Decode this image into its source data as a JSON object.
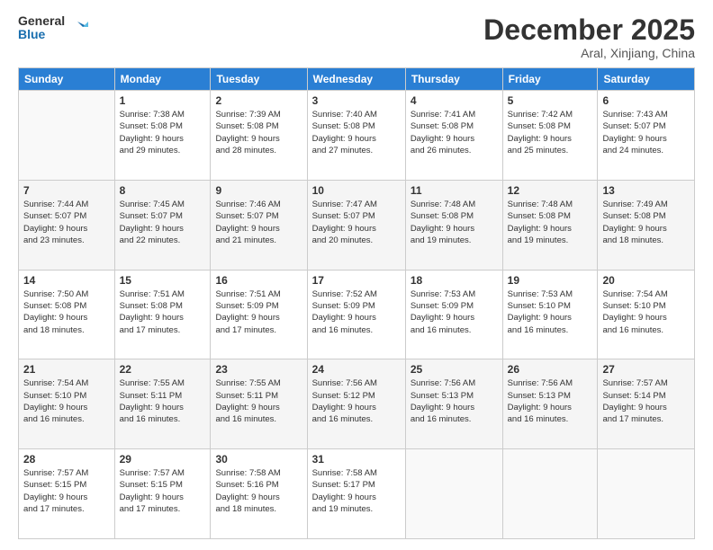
{
  "logo": {
    "line1": "General",
    "line2": "Blue"
  },
  "header": {
    "title": "December 2025",
    "location": "Aral, Xinjiang, China"
  },
  "weekdays": [
    "Sunday",
    "Monday",
    "Tuesday",
    "Wednesday",
    "Thursday",
    "Friday",
    "Saturday"
  ],
  "weeks": [
    [
      {
        "day": "",
        "info": ""
      },
      {
        "day": "1",
        "info": "Sunrise: 7:38 AM\nSunset: 5:08 PM\nDaylight: 9 hours\nand 29 minutes."
      },
      {
        "day": "2",
        "info": "Sunrise: 7:39 AM\nSunset: 5:08 PM\nDaylight: 9 hours\nand 28 minutes."
      },
      {
        "day": "3",
        "info": "Sunrise: 7:40 AM\nSunset: 5:08 PM\nDaylight: 9 hours\nand 27 minutes."
      },
      {
        "day": "4",
        "info": "Sunrise: 7:41 AM\nSunset: 5:08 PM\nDaylight: 9 hours\nand 26 minutes."
      },
      {
        "day": "5",
        "info": "Sunrise: 7:42 AM\nSunset: 5:08 PM\nDaylight: 9 hours\nand 25 minutes."
      },
      {
        "day": "6",
        "info": "Sunrise: 7:43 AM\nSunset: 5:07 PM\nDaylight: 9 hours\nand 24 minutes."
      }
    ],
    [
      {
        "day": "7",
        "info": "Sunrise: 7:44 AM\nSunset: 5:07 PM\nDaylight: 9 hours\nand 23 minutes."
      },
      {
        "day": "8",
        "info": "Sunrise: 7:45 AM\nSunset: 5:07 PM\nDaylight: 9 hours\nand 22 minutes."
      },
      {
        "day": "9",
        "info": "Sunrise: 7:46 AM\nSunset: 5:07 PM\nDaylight: 9 hours\nand 21 minutes."
      },
      {
        "day": "10",
        "info": "Sunrise: 7:47 AM\nSunset: 5:07 PM\nDaylight: 9 hours\nand 20 minutes."
      },
      {
        "day": "11",
        "info": "Sunrise: 7:48 AM\nSunset: 5:08 PM\nDaylight: 9 hours\nand 19 minutes."
      },
      {
        "day": "12",
        "info": "Sunrise: 7:48 AM\nSunset: 5:08 PM\nDaylight: 9 hours\nand 19 minutes."
      },
      {
        "day": "13",
        "info": "Sunrise: 7:49 AM\nSunset: 5:08 PM\nDaylight: 9 hours\nand 18 minutes."
      }
    ],
    [
      {
        "day": "14",
        "info": "Sunrise: 7:50 AM\nSunset: 5:08 PM\nDaylight: 9 hours\nand 18 minutes."
      },
      {
        "day": "15",
        "info": "Sunrise: 7:51 AM\nSunset: 5:08 PM\nDaylight: 9 hours\nand 17 minutes."
      },
      {
        "day": "16",
        "info": "Sunrise: 7:51 AM\nSunset: 5:09 PM\nDaylight: 9 hours\nand 17 minutes."
      },
      {
        "day": "17",
        "info": "Sunrise: 7:52 AM\nSunset: 5:09 PM\nDaylight: 9 hours\nand 16 minutes."
      },
      {
        "day": "18",
        "info": "Sunrise: 7:53 AM\nSunset: 5:09 PM\nDaylight: 9 hours\nand 16 minutes."
      },
      {
        "day": "19",
        "info": "Sunrise: 7:53 AM\nSunset: 5:10 PM\nDaylight: 9 hours\nand 16 minutes."
      },
      {
        "day": "20",
        "info": "Sunrise: 7:54 AM\nSunset: 5:10 PM\nDaylight: 9 hours\nand 16 minutes."
      }
    ],
    [
      {
        "day": "21",
        "info": "Sunrise: 7:54 AM\nSunset: 5:10 PM\nDaylight: 9 hours\nand 16 minutes."
      },
      {
        "day": "22",
        "info": "Sunrise: 7:55 AM\nSunset: 5:11 PM\nDaylight: 9 hours\nand 16 minutes."
      },
      {
        "day": "23",
        "info": "Sunrise: 7:55 AM\nSunset: 5:11 PM\nDaylight: 9 hours\nand 16 minutes."
      },
      {
        "day": "24",
        "info": "Sunrise: 7:56 AM\nSunset: 5:12 PM\nDaylight: 9 hours\nand 16 minutes."
      },
      {
        "day": "25",
        "info": "Sunrise: 7:56 AM\nSunset: 5:13 PM\nDaylight: 9 hours\nand 16 minutes."
      },
      {
        "day": "26",
        "info": "Sunrise: 7:56 AM\nSunset: 5:13 PM\nDaylight: 9 hours\nand 16 minutes."
      },
      {
        "day": "27",
        "info": "Sunrise: 7:57 AM\nSunset: 5:14 PM\nDaylight: 9 hours\nand 17 minutes."
      }
    ],
    [
      {
        "day": "28",
        "info": "Sunrise: 7:57 AM\nSunset: 5:15 PM\nDaylight: 9 hours\nand 17 minutes."
      },
      {
        "day": "29",
        "info": "Sunrise: 7:57 AM\nSunset: 5:15 PM\nDaylight: 9 hours\nand 17 minutes."
      },
      {
        "day": "30",
        "info": "Sunrise: 7:58 AM\nSunset: 5:16 PM\nDaylight: 9 hours\nand 18 minutes."
      },
      {
        "day": "31",
        "info": "Sunrise: 7:58 AM\nSunset: 5:17 PM\nDaylight: 9 hours\nand 19 minutes."
      },
      {
        "day": "",
        "info": ""
      },
      {
        "day": "",
        "info": ""
      },
      {
        "day": "",
        "info": ""
      }
    ]
  ]
}
